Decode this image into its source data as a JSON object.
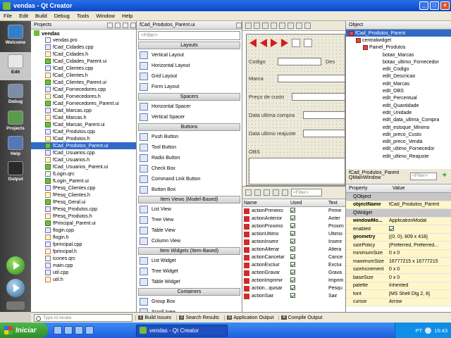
{
  "window": {
    "title": "vendas - Qt Creator"
  },
  "menubar": [
    "File",
    "Edit",
    "Build",
    "Debug",
    "Tools",
    "Window",
    "Help"
  ],
  "modes": [
    {
      "label": "Welcome",
      "icon": "welcome-icon"
    },
    {
      "label": "Edit",
      "icon": "edit-icon",
      "active": true
    },
    {
      "label": "Debug",
      "icon": "debug-icon"
    },
    {
      "label": "Projects",
      "icon": "projects-icon"
    },
    {
      "label": "Help",
      "icon": "help-icon"
    },
    {
      "label": "Output",
      "icon": "output-icon"
    }
  ],
  "projects": {
    "header": "Projects",
    "root": "vendas",
    "files": [
      {
        "name": "vendas.pro",
        "type": "pro"
      },
      {
        "name": "fCad_Cidades.cpp",
        "type": "cpp"
      },
      {
        "name": "fCad_Cidades.h",
        "type": "h"
      },
      {
        "name": "fCad_Cidades_Parent.ui",
        "type": "ui"
      },
      {
        "name": "fCad_Clientes.cpp",
        "type": "cpp"
      },
      {
        "name": "fCad_Clientes.h",
        "type": "h"
      },
      {
        "name": "fCad_Clientes_Parent.ui",
        "type": "ui"
      },
      {
        "name": "fCad_Fornecedores.cpp",
        "type": "cpp"
      },
      {
        "name": "fCad_Fornecedores.h",
        "type": "h"
      },
      {
        "name": "fCad_Fornecedores_Parent.ui",
        "type": "ui"
      },
      {
        "name": "fCad_Marcas.cpp",
        "type": "cpp"
      },
      {
        "name": "fCad_Marcas.h",
        "type": "h"
      },
      {
        "name": "fCad_Marcas_Parent.ui",
        "type": "ui"
      },
      {
        "name": "fCad_Produtos.cpp",
        "type": "cpp"
      },
      {
        "name": "fCad_Produtos.h",
        "type": "h"
      },
      {
        "name": "fCad_Produtos_Parent.ui",
        "type": "ui",
        "selected": true
      },
      {
        "name": "fCad_Usuarios.cpp",
        "type": "cpp"
      },
      {
        "name": "fCad_Usuarios.h",
        "type": "h"
      },
      {
        "name": "fCad_Usuarios_Parent.ui",
        "type": "ui"
      },
      {
        "name": "fLogin.qrc",
        "type": "pro"
      },
      {
        "name": "fLogin_Parent.ui",
        "type": "ui"
      },
      {
        "name": "fPesq_Clientes.cpp",
        "type": "cpp"
      },
      {
        "name": "fPesq_Clientes.h",
        "type": "h"
      },
      {
        "name": "fPesq_Geral.ui",
        "type": "ui"
      },
      {
        "name": "fPesq_Produtos.cpp",
        "type": "cpp"
      },
      {
        "name": "fPesq_Produtos.h",
        "type": "h"
      },
      {
        "name": "fPrincipal_Parent.ui",
        "type": "ui"
      },
      {
        "name": "flogin.cpp",
        "type": "cpp"
      },
      {
        "name": "flogin.h",
        "type": "h"
      },
      {
        "name": "fprincipal.cpp",
        "type": "cpp"
      },
      {
        "name": "fprincipal.h",
        "type": "h"
      },
      {
        "name": "icones.qrc",
        "type": "pro"
      },
      {
        "name": "main.cpp",
        "type": "cpp"
      },
      {
        "name": "util.cpp",
        "type": "cpp"
      },
      {
        "name": "util.h",
        "type": "h"
      }
    ]
  },
  "widgetbox": {
    "file": "fCad_Produtos_Parent.ui",
    "filter_placeholder": "<Filter>",
    "groups": [
      {
        "title": "Layouts",
        "items": [
          "Vertical Layout",
          "Horizontal Layout",
          "Grid Layout",
          "Form Layout"
        ]
      },
      {
        "title": "Spacers",
        "items": [
          "Horizontal Spacer",
          "Vertical Spacer"
        ]
      },
      {
        "title": "Buttons",
        "items": [
          "Push Button",
          "Tool Button",
          "Radio Button",
          "Check Box",
          "Command Link Button",
          "Button Box"
        ]
      },
      {
        "title": "Item Views (Model-Based)",
        "items": [
          "List View",
          "Tree View",
          "Table View",
          "Column View"
        ]
      },
      {
        "title": "Item Widgets (Item-Based)",
        "items": [
          "List Widget",
          "Tree Widget",
          "Table Widget"
        ]
      },
      {
        "title": "Containers",
        "items": [
          "Group Box",
          "Scroll Area"
        ]
      }
    ]
  },
  "form": {
    "labels": [
      "Codigo",
      "Des",
      "Marca",
      "Preço de custo",
      "Data ultima compra",
      "Data ultimo reajuste",
      "OBS"
    ]
  },
  "object_inspector": {
    "header": "Object",
    "items": [
      {
        "name": "fCad_Produtos_Parent",
        "level": 0,
        "selected": true
      },
      {
        "name": "centralwidget",
        "level": 1
      },
      {
        "name": "Painel_Produtos",
        "level": 2
      },
      {
        "name": "botao_Marcas",
        "level": 3
      },
      {
        "name": "botao_ultimo_Fornecedor",
        "level": 3
      },
      {
        "name": "edit_Codigo",
        "level": 3
      },
      {
        "name": "edit_Descricao",
        "level": 3
      },
      {
        "name": "edit_Marcas",
        "level": 3
      },
      {
        "name": "edit_OBS",
        "level": 3
      },
      {
        "name": "edit_Percentual",
        "level": 3
      },
      {
        "name": "edit_Quantidade",
        "level": 3
      },
      {
        "name": "edit_Unidade",
        "level": 3
      },
      {
        "name": "edit_data_ultima_Compra",
        "level": 3
      },
      {
        "name": "edit_estoque_Minimo",
        "level": 3
      },
      {
        "name": "edit_preco_Custo",
        "level": 3
      },
      {
        "name": "edit_preco_Venda",
        "level": 3
      },
      {
        "name": "edit_ultimo_Fornecedor",
        "level": 3
      },
      {
        "name": "edit_ultimo_Reajuste",
        "level": 3
      }
    ]
  },
  "property_editor": {
    "title_line1": "fCad_Produtos_Parent",
    "title_line2": "QMainWindow",
    "filter_placeholder": "<Filter>",
    "col_property": "Property",
    "col_value": "Value",
    "rows": [
      {
        "kind": "class",
        "name": "QObject"
      },
      {
        "name": "objectName",
        "value": "fCad_Produtos_Parent",
        "bold": true,
        "yellow": true
      },
      {
        "kind": "class",
        "name": "QWidget"
      },
      {
        "name": "windowMo...",
        "value": "ApplicationModal",
        "bold": true,
        "yellow": true
      },
      {
        "name": "enabled",
        "value": "",
        "check": true,
        "yellow": true
      },
      {
        "name": "geometry",
        "value": "[(0, 0), 809 x 418]",
        "bold": true,
        "yellow": true
      },
      {
        "name": "sizePolicy",
        "value": "[Preferred, Preferred...",
        "yellow": true
      },
      {
        "name": "minimumSize",
        "value": "0 x 0",
        "yellow": true
      },
      {
        "name": "maximumSize",
        "value": "16777215 x 16777215",
        "yellow": true
      },
      {
        "name": "sizeIncrement",
        "value": "0 x 0",
        "yellow": true
      },
      {
        "name": "baseSize",
        "value": "0 x 0",
        "yellow": true
      },
      {
        "name": "palette",
        "value": "Inherited",
        "yellow": true
      },
      {
        "name": "font",
        "value": "[MS Shell Dlg 2, 8]",
        "yellow": true
      },
      {
        "name": "cursor",
        "value": "Arrow",
        "yellow": true
      }
    ]
  },
  "action_editor": {
    "filter_placeholder": "<Filter>",
    "col_name": "Name",
    "col_used": "Used",
    "col_text": "Text",
    "rows": [
      {
        "name": "actionPrimeiro",
        "text": "Prime"
      },
      {
        "name": "actionAnterior",
        "text": "Anter"
      },
      {
        "name": "actionProximo",
        "text": "Proxim"
      },
      {
        "name": "actionUltimo",
        "text": "Ultimo"
      },
      {
        "name": "actionInserir",
        "text": "Inserir"
      },
      {
        "name": "actionAlterar",
        "text": "Altera"
      },
      {
        "name": "actionCancelar",
        "text": "Cance"
      },
      {
        "name": "actionExcluir",
        "text": "Exclui"
      },
      {
        "name": "actionGravar",
        "text": "Grava"
      },
      {
        "name": "actionImprimir",
        "text": "Imprim"
      },
      {
        "name": "action...quisar",
        "text": "Pesqu"
      },
      {
        "name": "actionSair",
        "text": "Sair"
      }
    ]
  },
  "output_bar": {
    "locate_placeholder": "Type to locate",
    "tabs": [
      {
        "num": "1",
        "label": "Build Issues"
      },
      {
        "num": "2",
        "label": "Search Results"
      },
      {
        "num": "3",
        "label": "Application Output"
      },
      {
        "num": "4",
        "label": "Compile Output"
      }
    ]
  },
  "taskbar": {
    "start": "Iniciar",
    "task": "vendas - Qt Creator",
    "lang": "PT",
    "clock": "15:43"
  }
}
